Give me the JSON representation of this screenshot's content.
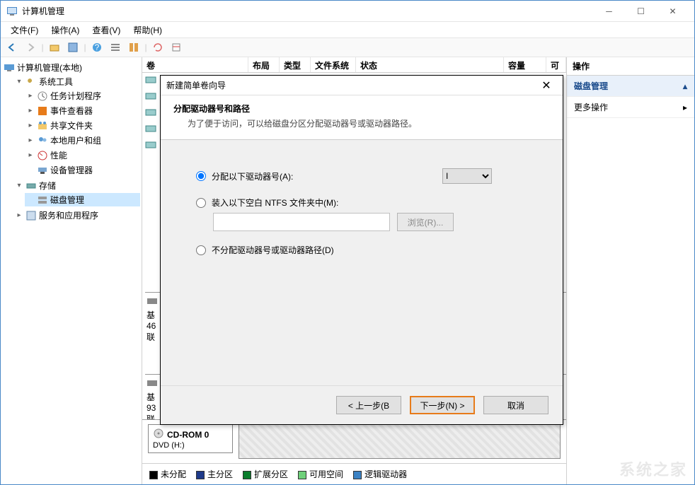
{
  "window": {
    "title": "计算机管理"
  },
  "menubar": [
    "文件(F)",
    "操作(A)",
    "查看(V)",
    "帮助(H)"
  ],
  "tree": {
    "root": "计算机管理(本地)",
    "system_tools": "系统工具",
    "task_scheduler": "任务计划程序",
    "event_viewer": "事件查看器",
    "shared_folders": "共享文件夹",
    "local_users": "本地用户和组",
    "performance": "性能",
    "device_manager": "设备管理器",
    "storage": "存储",
    "disk_mgmt": "磁盘管理",
    "services_apps": "服务和应用程序"
  },
  "grid": {
    "cols": {
      "volume": "卷",
      "layout": "布局",
      "type": "类型",
      "fs": "文件系统",
      "status": "状态",
      "capacity": "容量",
      "free": "可"
    }
  },
  "disks": {
    "b_basic": "基",
    "b_46": "46",
    "b_online": "联",
    "c_basic": "基",
    "c_93": "93",
    "c_online": "联",
    "cdrom_title": "CD-ROM 0",
    "cdrom_sub": "DVD (H:)"
  },
  "legend": {
    "unalloc": "未分配",
    "primary": "主分区",
    "extended": "扩展分区",
    "free": "可用空间",
    "logical": "逻辑驱动器"
  },
  "actions": {
    "header": "操作",
    "disk_mgmt": "磁盘管理",
    "more": "更多操作"
  },
  "dialog": {
    "title": "新建简单卷向导",
    "heading": "分配驱动器号和路径",
    "subheading": "为了便于访问，可以给磁盘分区分配驱动器号或驱动器路径。",
    "opt_assign": "分配以下驱动器号(A):",
    "drive_letter": "I",
    "opt_mount": "装入以下空白 NTFS 文件夹中(M):",
    "browse": "浏览(R)...",
    "opt_none": "不分配驱动器号或驱动器路径(D)",
    "back": "< 上一步(B",
    "next": "下一步(N) >",
    "cancel": "取消"
  },
  "watermark": "系统之家"
}
